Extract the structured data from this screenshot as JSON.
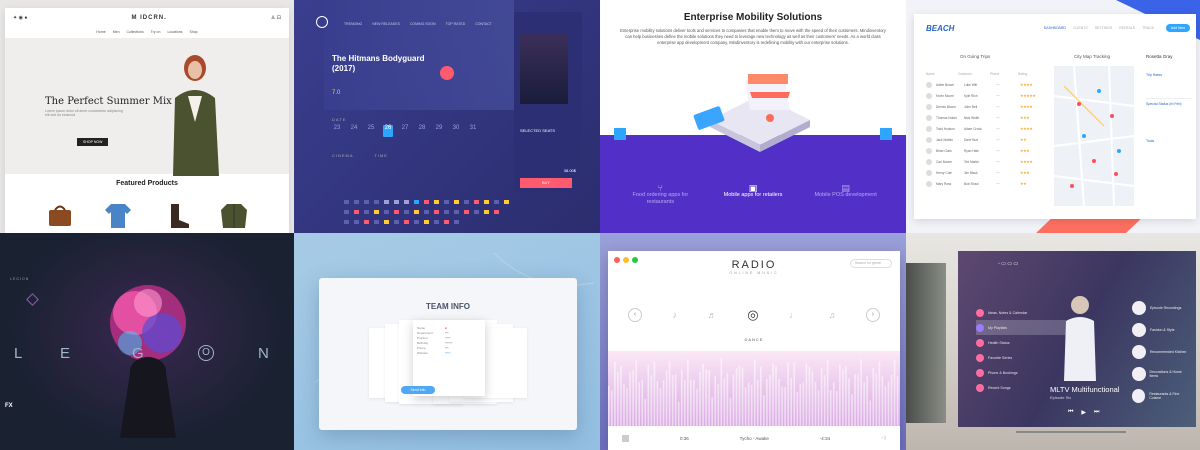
{
  "shop": {
    "logo": "M IDCRN.",
    "nav": [
      "Home",
      "Men",
      "Collections",
      "Try on",
      "Locations",
      "Shop"
    ],
    "hero_title": "The Perfect Summer Mix",
    "hero_sub": "Lorem ipsum dolor sit amet consectetur adipiscing elit sed do eiusmod",
    "hero_button": "SHOP NOW",
    "featured": "Featured Products"
  },
  "cinema": {
    "nav": [
      "TRENDING",
      "NEW RELEASES",
      "COMING SOON",
      "TOP RATED",
      "CONTACT"
    ],
    "movie_title": "The Hitmans Bodyguard (2017)",
    "rating": "7.0",
    "date_label": "DATE",
    "dates": [
      "23",
      "24",
      "25",
      "26",
      "27",
      "28",
      "29",
      "30",
      "31"
    ],
    "selected_date": "26",
    "cinema_label": "CINEMA",
    "time_label": "TIME",
    "selected_seats": "SELECTED SEATS",
    "total": "38.00$",
    "buy": "BUY"
  },
  "mobility": {
    "title": "Enterprise Mobility Solutions",
    "description": "Enterprise mobility solutions deliver tools and services to companies that enable them to move with the speed of their customers. Mindinventory can help businesses define the mobile solutions they need to leverage new technology as well as their customers' needs. As a world class enterprise app development company, Mindinventory is redefining mobility with our enterprise solutions.",
    "store_sign": "Retail Store",
    "items": [
      {
        "label": "Food ordering apps for restaurants"
      },
      {
        "label": "Mobile apps for retailers"
      },
      {
        "label": "Mobile POS development"
      }
    ]
  },
  "beach": {
    "logo": "BEACH",
    "nav": [
      "DASHBOARD",
      "CLIENTS",
      "SETTINGS",
      "RENTALS",
      "TRACK"
    ],
    "add_button": "Add New",
    "ongoing": "On Going Trips",
    "map_title": "City Map Tracking",
    "columns": [
      "Name",
      "Customer",
      "Phone",
      "Rating"
    ],
    "rows": [
      {
        "name": "Adele Brown",
        "customer": "Luke Wilt",
        "rating": "★★★★"
      },
      {
        "name": "Kevin Moore",
        "customer": "Kyle Rich",
        "rating": "★★★★★"
      },
      {
        "name": "Dennis Bloom",
        "customer": "John Bell",
        "rating": "★★★★"
      },
      {
        "name": "Thomas Nolan",
        "customer": "Nick Wolfe",
        "rating": "★★★"
      },
      {
        "name": "Todd Hudson",
        "customer": "Adam Crook",
        "rating": "★★★★"
      },
      {
        "name": "Jack Mathis",
        "customer": "Dave Burt",
        "rating": "★★"
      },
      {
        "name": "Brian Clark",
        "customer": "Ryan Hale",
        "rating": "★★★"
      },
      {
        "name": "Carl Boone",
        "customer": "Ted Martin",
        "rating": "★★★★"
      },
      {
        "name": "Henry Cole",
        "customer": "Jim Black",
        "rating": "★★★"
      },
      {
        "name": "Mary Ross",
        "customer": "Bob Shaw",
        "rating": "★★"
      }
    ],
    "profile_name": "Rosetta Gray",
    "trip_rates": "Trip Rates",
    "special_status": "Special Status (In Feb)",
    "tools": "Tools"
  },
  "legion": {
    "top_left": "LEGION",
    "letters": [
      "L",
      "E",
      "G",
      "O",
      "N"
    ],
    "brand": "FX"
  },
  "team": {
    "title": "TEAM INFO",
    "fields": [
      "Name",
      "Department",
      "Position",
      "Birthday",
      "Phone",
      "Website"
    ],
    "button": "Send Info"
  },
  "radio": {
    "title": "RADIO",
    "subtitle": "ONLINE MUSIC",
    "search": "Search for genre",
    "genre_selected": "DANCE",
    "time_start": "0:36",
    "track": "Tycho - Awake",
    "time_end": "-4:34"
  },
  "mltv": {
    "menu": [
      "Ideas, Notes & Calendar",
      "My Playlists",
      "Health Status",
      "Favorite Series",
      "Phone & Bookings",
      "Recent Songs"
    ],
    "menu_sub": [
      "",
      "",
      "Complete",
      "",
      "",
      "Complete"
    ],
    "title": "MLTV Multifunctional",
    "episode": "Episode Six",
    "side": [
      "Episode Recordings",
      "Fashion & Style",
      "Recommended Kitchen",
      "Decorations & Home Items",
      "Restaurants & Fine Cuisine"
    ]
  }
}
